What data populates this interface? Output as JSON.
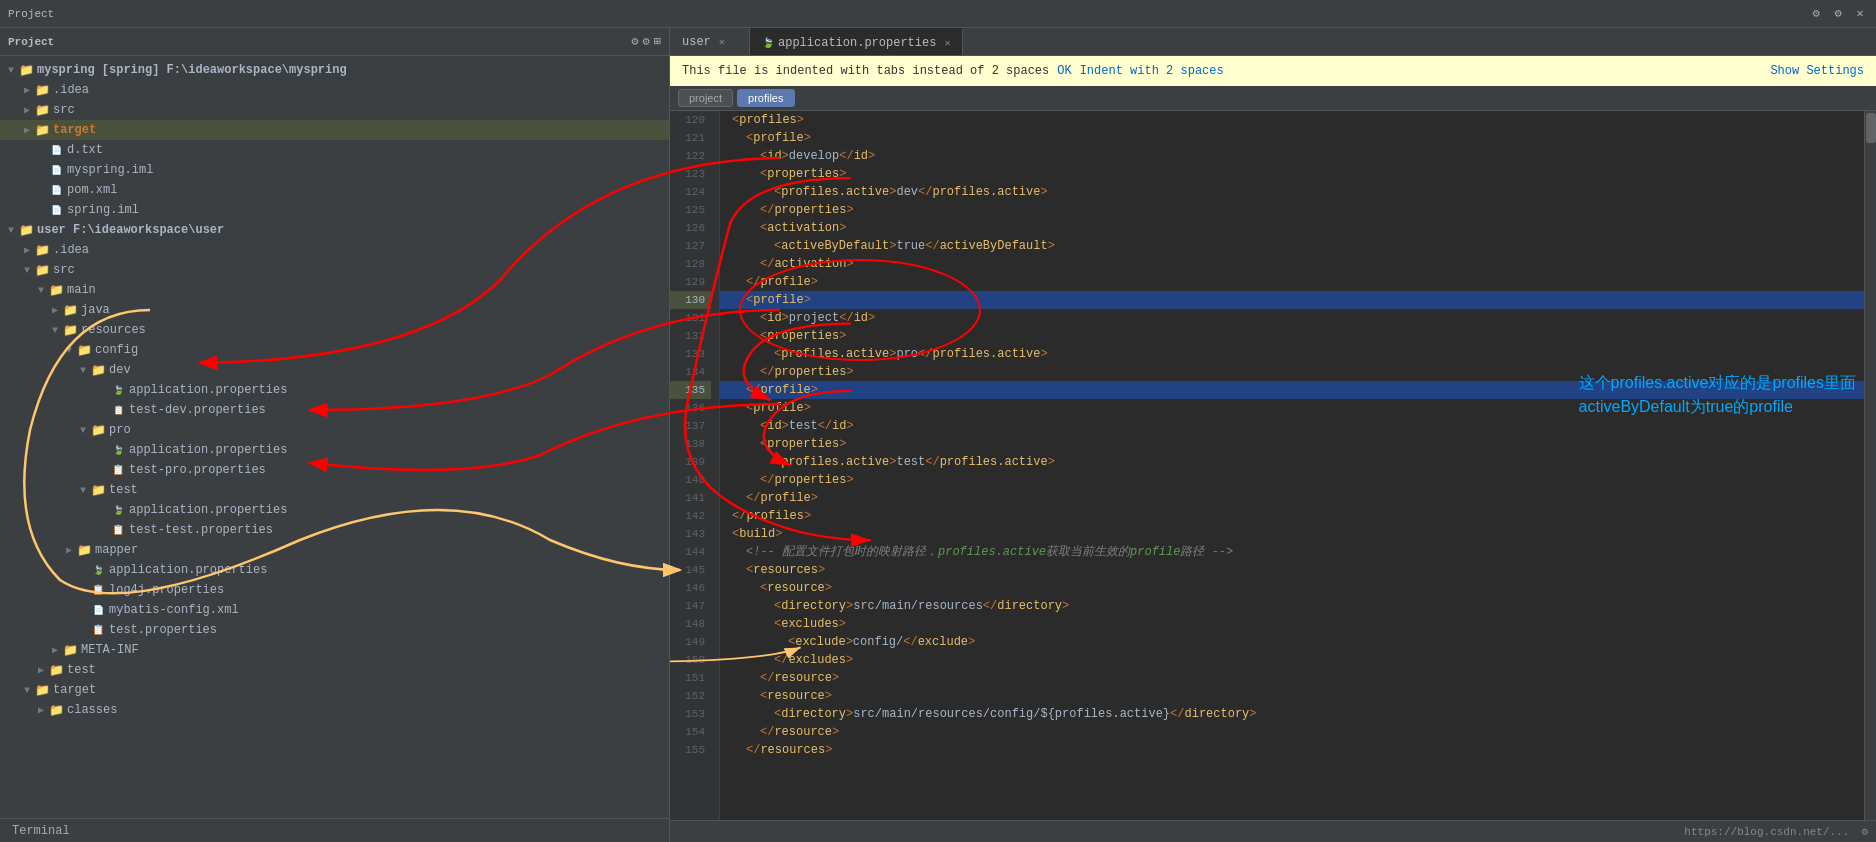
{
  "window": {
    "title": "Project"
  },
  "tabs": {
    "items": [
      {
        "label": "user",
        "active": false,
        "closable": true
      },
      {
        "label": "application.properties",
        "active": true,
        "closable": true
      }
    ]
  },
  "notification": {
    "message": "This file is indented with tabs instead of 2 spaces",
    "ok_label": "OK",
    "indent_label": "Indent with 2 spaces",
    "settings_label": "Show Settings"
  },
  "editor_tabs": {
    "items": [
      {
        "label": "project",
        "active": false
      },
      {
        "label": "profiles",
        "active": true
      }
    ]
  },
  "project_tree": {
    "items": [
      {
        "indent": 0,
        "type": "project",
        "label": "myspring [spring] F:\\ideaworkspace\\myspring",
        "expanded": true
      },
      {
        "indent": 1,
        "type": "folder",
        "label": ".idea",
        "expanded": false
      },
      {
        "indent": 1,
        "type": "folder",
        "label": "src",
        "expanded": false
      },
      {
        "indent": 1,
        "type": "folder",
        "label": "target",
        "expanded": false,
        "highlighted": true
      },
      {
        "indent": 1,
        "type": "file-txt",
        "label": "d.txt"
      },
      {
        "indent": 1,
        "type": "file-iml",
        "label": "myspring.iml"
      },
      {
        "indent": 1,
        "type": "file-xml",
        "label": "pom.xml"
      },
      {
        "indent": 1,
        "type": "file-iml",
        "label": "spring.iml"
      },
      {
        "indent": 0,
        "type": "project",
        "label": "user F:\\ideaworkspace\\user",
        "expanded": true
      },
      {
        "indent": 1,
        "type": "folder",
        "label": ".idea",
        "expanded": false
      },
      {
        "indent": 1,
        "type": "folder",
        "label": "src",
        "expanded": true
      },
      {
        "indent": 2,
        "type": "folder",
        "label": "main",
        "expanded": true
      },
      {
        "indent": 3,
        "type": "folder",
        "label": "java",
        "expanded": false
      },
      {
        "indent": 3,
        "type": "folder",
        "label": "resources",
        "expanded": true
      },
      {
        "indent": 4,
        "type": "folder",
        "label": "config",
        "expanded": true
      },
      {
        "indent": 5,
        "type": "folder",
        "label": "dev",
        "expanded": true
      },
      {
        "indent": 6,
        "type": "file-props",
        "label": "application.properties"
      },
      {
        "indent": 6,
        "type": "file-props",
        "label": "test-dev.properties"
      },
      {
        "indent": 5,
        "type": "folder",
        "label": "pro",
        "expanded": true
      },
      {
        "indent": 6,
        "type": "file-props",
        "label": "application.properties"
      },
      {
        "indent": 6,
        "type": "file-props",
        "label": "test-pro.properties"
      },
      {
        "indent": 5,
        "type": "folder",
        "label": "test",
        "expanded": true
      },
      {
        "indent": 6,
        "type": "file-props",
        "label": "application.properties"
      },
      {
        "indent": 6,
        "type": "file-props",
        "label": "test-test.properties"
      },
      {
        "indent": 4,
        "type": "folder",
        "label": "mapper",
        "expanded": false
      },
      {
        "indent": 4,
        "type": "file-props",
        "label": "application.properties"
      },
      {
        "indent": 4,
        "type": "file-props",
        "label": "log4j.properties"
      },
      {
        "indent": 4,
        "type": "file-xml",
        "label": "mybatis-config.xml"
      },
      {
        "indent": 4,
        "type": "file-props",
        "label": "test.properties"
      },
      {
        "indent": 3,
        "type": "folder",
        "label": "META-INF",
        "expanded": false
      },
      {
        "indent": 2,
        "type": "folder",
        "label": "test",
        "expanded": false
      },
      {
        "indent": 1,
        "type": "folder",
        "label": "target",
        "expanded": false
      },
      {
        "indent": 2,
        "type": "folder",
        "label": "classes",
        "expanded": false
      }
    ]
  },
  "code": {
    "lines": [
      {
        "num": 120,
        "content": "    <profiles>",
        "highlighted": false
      },
      {
        "num": 121,
        "content": "        <profile>",
        "highlighted": false
      },
      {
        "num": 122,
        "content": "            <id>develop</id>",
        "highlighted": false
      },
      {
        "num": 123,
        "content": "            <properties>",
        "highlighted": false
      },
      {
        "num": 124,
        "content": "                <profiles.active>dev</profiles.active>",
        "highlighted": false
      },
      {
        "num": 125,
        "content": "            </properties>",
        "highlighted": false
      },
      {
        "num": 126,
        "content": "            <activation>",
        "highlighted": false
      },
      {
        "num": 127,
        "content": "                <activeByDefault>true</activeByDefault>",
        "highlighted": false
      },
      {
        "num": 128,
        "content": "            </activation>",
        "highlighted": false
      },
      {
        "num": 129,
        "content": "        </profile>",
        "highlighted": false
      },
      {
        "num": 130,
        "content": "        <profile>",
        "highlighted": true
      },
      {
        "num": 131,
        "content": "            <id>project</id>",
        "highlighted": false
      },
      {
        "num": 132,
        "content": "            <properties>",
        "highlighted": false
      },
      {
        "num": 133,
        "content": "                <profiles.active>pro</profiles.active>",
        "highlighted": false
      },
      {
        "num": 134,
        "content": "            </properties>",
        "highlighted": false
      },
      {
        "num": 135,
        "content": "        </profile>",
        "highlighted": true
      },
      {
        "num": 136,
        "content": "        <profile>",
        "highlighted": false
      },
      {
        "num": 137,
        "content": "            <id>test</id>",
        "highlighted": false
      },
      {
        "num": 138,
        "content": "            <properties>",
        "highlighted": false
      },
      {
        "num": 139,
        "content": "                <profiles.active>test</profiles.active>",
        "highlighted": false
      },
      {
        "num": 140,
        "content": "            </properties>",
        "highlighted": false
      },
      {
        "num": 141,
        "content": "        </profile>",
        "highlighted": false
      },
      {
        "num": 142,
        "content": "    </profiles>",
        "highlighted": false
      },
      {
        "num": 143,
        "content": "    <build>",
        "highlighted": false
      },
      {
        "num": 144,
        "content": "        <!-- 配置文件打包时的映射路径，profiles.active获取当前生效的profile路径 -->",
        "highlighted": false
      },
      {
        "num": 145,
        "content": "        <resources>",
        "highlighted": false
      },
      {
        "num": 146,
        "content": "            <resource>",
        "highlighted": false
      },
      {
        "num": 147,
        "content": "                <directory>src/main/resources</directory>",
        "highlighted": false
      },
      {
        "num": 148,
        "content": "                <excludes>",
        "highlighted": false
      },
      {
        "num": 149,
        "content": "                    <exclude>config/</exclude>",
        "highlighted": false
      },
      {
        "num": 150,
        "content": "                </excludes>",
        "highlighted": false
      },
      {
        "num": 151,
        "content": "            </resource>",
        "highlighted": false
      },
      {
        "num": 152,
        "content": "            <resource>",
        "highlighted": false
      },
      {
        "num": 153,
        "content": "                <directory>src/main/resources/config/${profiles.active}</directory>",
        "highlighted": false
      },
      {
        "num": 154,
        "content": "            </resource>",
        "highlighted": false
      },
      {
        "num": 155,
        "content": "        </resources>",
        "highlighted": false
      }
    ]
  },
  "annotation": {
    "line1": "这个profiles.active对应的是profiles里面",
    "line2": "activeByDefault为true的profile"
  },
  "status_bar": {
    "right_text": "https://blog.csdn.net/..."
  },
  "terminal": {
    "label": "Terminal"
  }
}
